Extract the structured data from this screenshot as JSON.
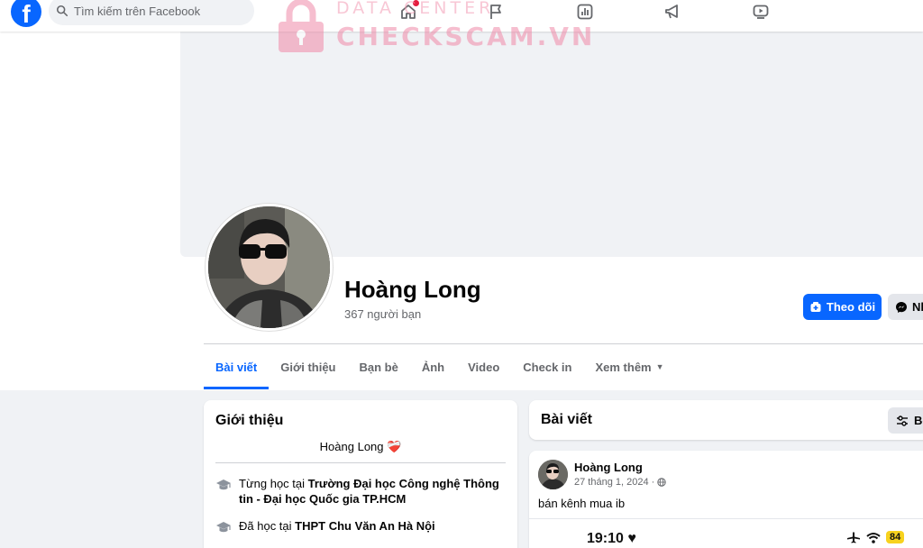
{
  "topbar": {
    "search_placeholder": "Tìm kiếm trên Facebook",
    "nav_icons": [
      "home-icon",
      "flag-icon",
      "chart-icon",
      "megaphone-icon",
      "video-icon"
    ],
    "brand_color": "#0866ff"
  },
  "watermark": {
    "line1": "DATA CENTER",
    "line2": "CHECKSCAM.VN"
  },
  "profile": {
    "name": "Hoàng Long",
    "friends": "367 người bạn",
    "follow_label": "Theo dõi",
    "message_label": "Nh"
  },
  "tabs": [
    {
      "label": "Bài viết",
      "active": true
    },
    {
      "label": "Giới thiệu"
    },
    {
      "label": "Bạn bè"
    },
    {
      "label": "Ảnh"
    },
    {
      "label": "Video"
    },
    {
      "label": "Check in"
    },
    {
      "label": "Xem thêm"
    }
  ],
  "intro": {
    "title": "Giới thiệu",
    "bio": "Hoàng Long",
    "bio_emoji": "❤️‍🩹",
    "items": [
      {
        "prefix": "Từng học tại ",
        "school": "Trường Đại học Công nghệ Thông tin - Đại học Quốc gia TP.HCM"
      },
      {
        "prefix": "Đã học tại ",
        "school": "THPT Chu Văn An Hà Nội"
      }
    ]
  },
  "posts": {
    "title": "Bài viết",
    "filter_label": "Bộ",
    "post": {
      "author": "Hoàng Long",
      "date": "27 tháng 1, 2024",
      "privacy_icon": "globe-icon",
      "text": "bán kênh mua ib",
      "phone_time": "19:10",
      "battery": "84"
    }
  }
}
